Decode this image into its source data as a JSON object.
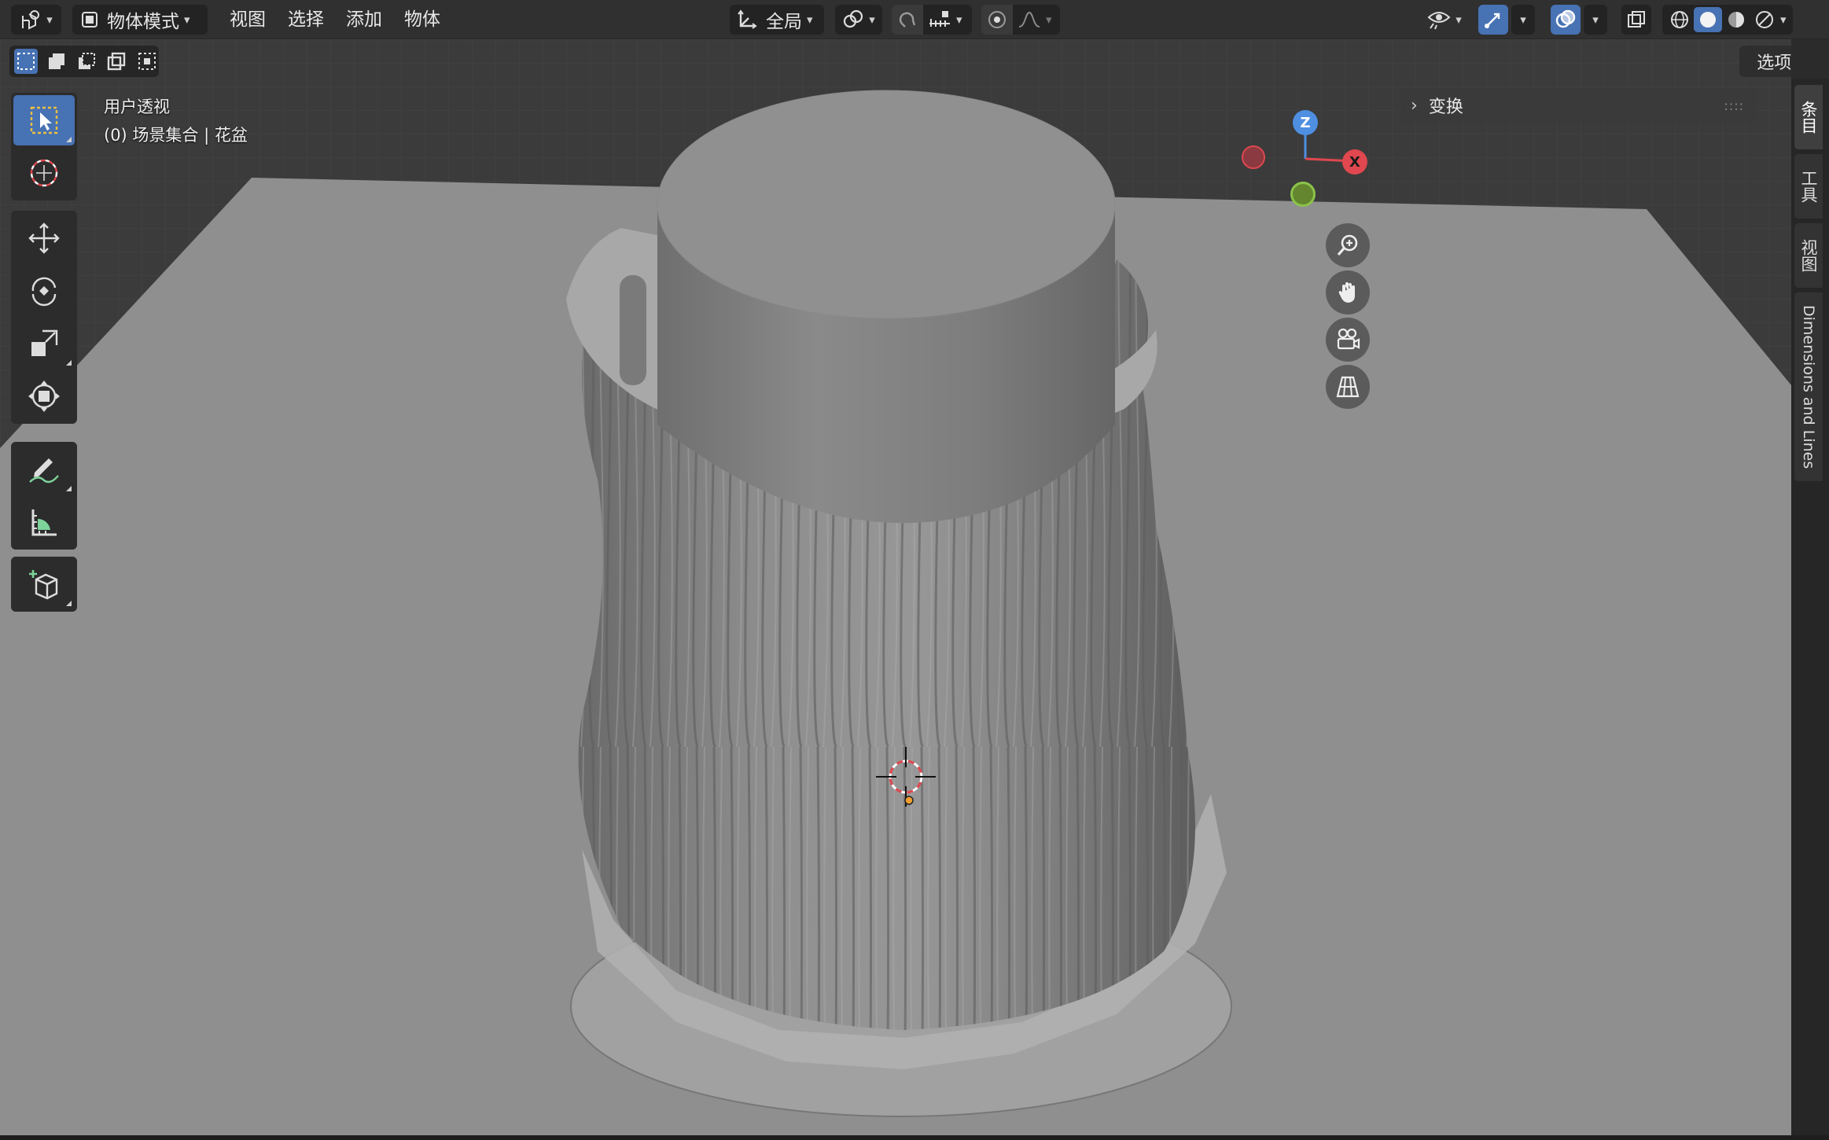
{
  "header": {
    "mode_label": "物体模式",
    "menus": [
      "视图",
      "选择",
      "添加",
      "物体"
    ],
    "orientation_label": "全局"
  },
  "toolbar": {
    "select_modes": [
      "select-new",
      "select-extend",
      "select-subtract",
      "select-invert",
      "select-intersect"
    ],
    "options_label": "选项",
    "tools": [
      "select-box",
      "cursor",
      "move",
      "rotate",
      "scale",
      "transform",
      "annotate",
      "measure",
      "add-cube"
    ]
  },
  "viewport": {
    "view_name": "用户透视",
    "collection_info": "(0) 场景集合 | 花盆",
    "axes": {
      "z": "Z",
      "x": "X"
    },
    "colors": {
      "x_axis": "#e0474f",
      "z_axis": "#4f8fe2",
      "y_axis": "#8bc34a"
    }
  },
  "sidebar": {
    "panel_title": "变换",
    "tabs": [
      "条目",
      "工具",
      "视图",
      "Dimensions and Lines"
    ]
  },
  "theme": {
    "accent": "#4772b3",
    "header_bg": "#303030",
    "viewport_bg": "#3b3b3b"
  }
}
